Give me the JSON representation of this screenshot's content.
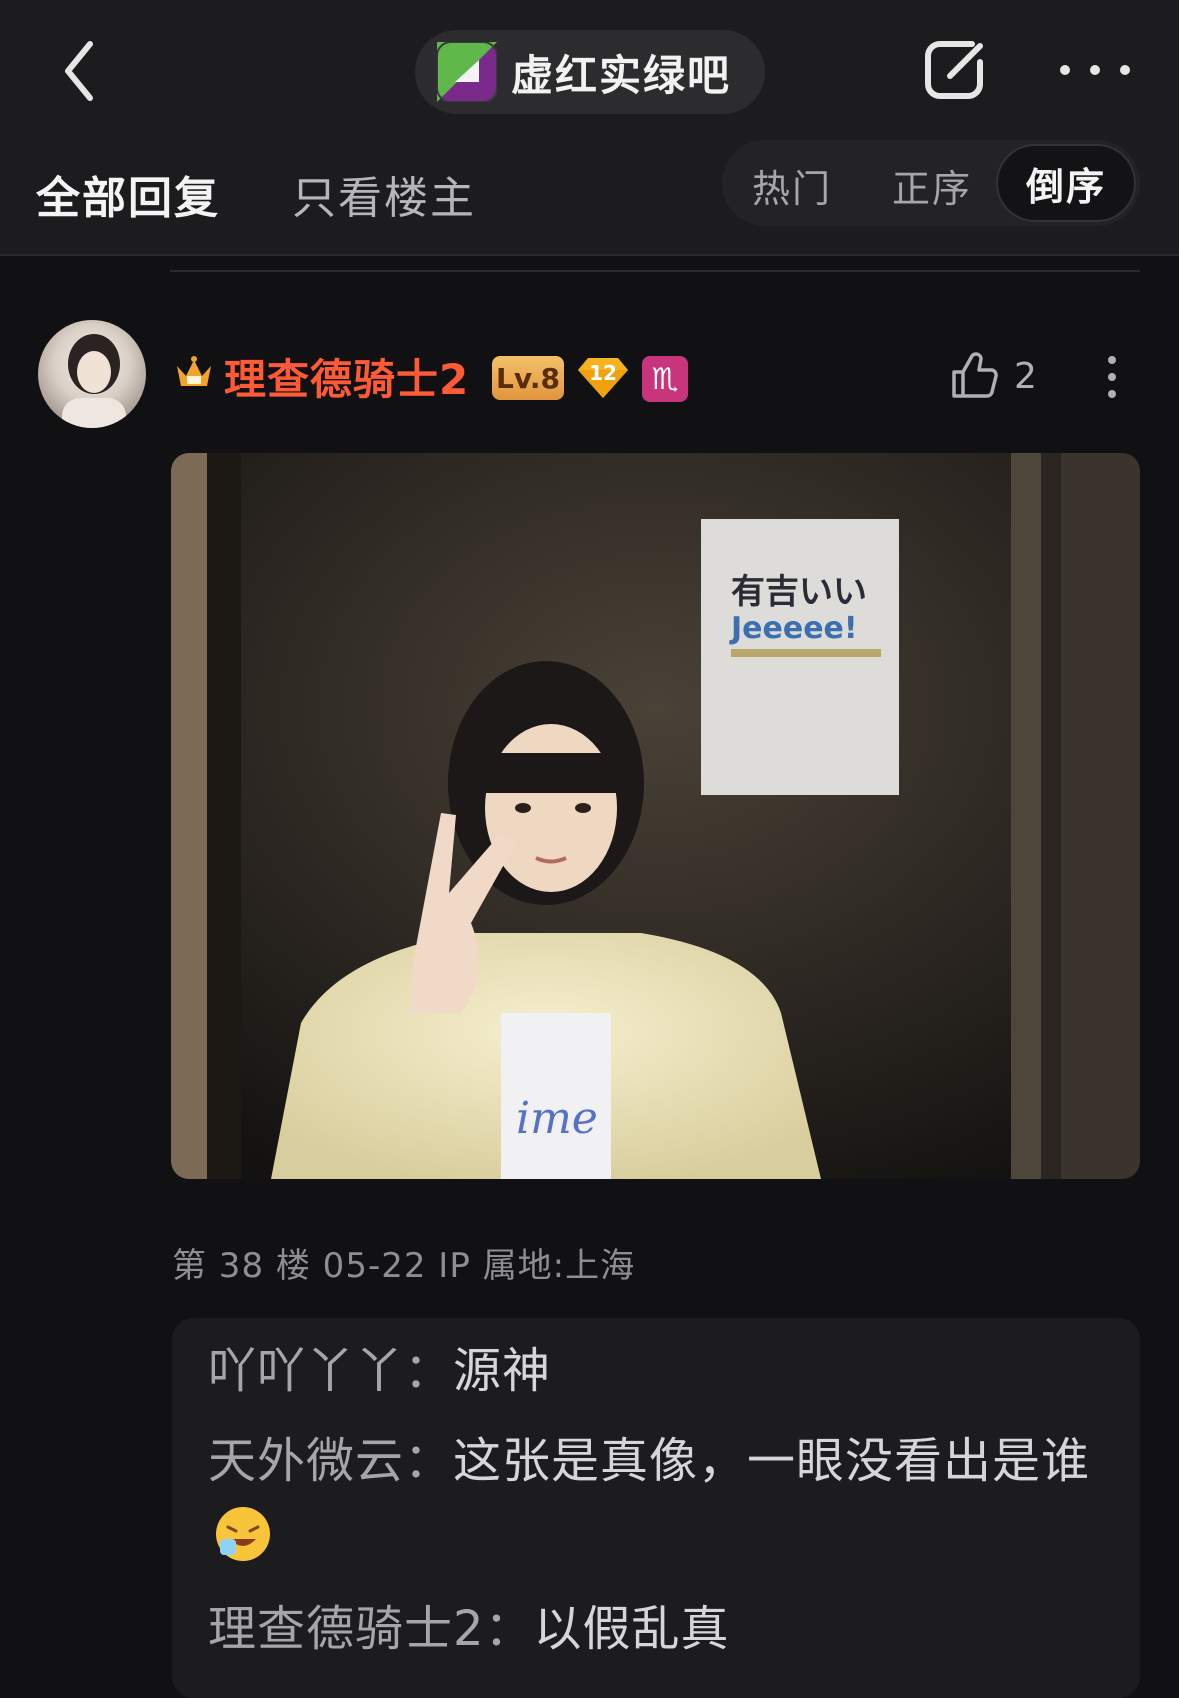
{
  "header": {
    "forum_name": "虚红实绿吧",
    "icons": [
      "back-icon",
      "forum-logo-icon",
      "edit-icon",
      "more-icon"
    ]
  },
  "tabs": {
    "all_replies": "全部回复",
    "op_only": "只看楼主",
    "sort": {
      "hot": "热门",
      "asc": "正序",
      "desc": "倒序",
      "selected": "倒序"
    }
  },
  "post": {
    "author": "理查德骑士2",
    "level": "Lv.8",
    "diamond_level": "12",
    "zodiac": "♏",
    "like_count": "2",
    "floor_meta": "第 38 楼   05-22   IP 属地:上海",
    "image_alt": "photo"
  },
  "replies": [
    {
      "author": "吖吖丫丫：",
      "text": "源神"
    },
    {
      "author": "天外微云：",
      "text": "这张是真像，一眼没看出是谁"
    },
    {
      "author": "理查德骑士2：",
      "text": "以假乱真"
    }
  ],
  "colors": {
    "background": "#111113",
    "bar": "#1c1c1e",
    "username": "#ff5a36",
    "level_badge": "#e0963d",
    "zodiac_badge": "#c8357d"
  }
}
